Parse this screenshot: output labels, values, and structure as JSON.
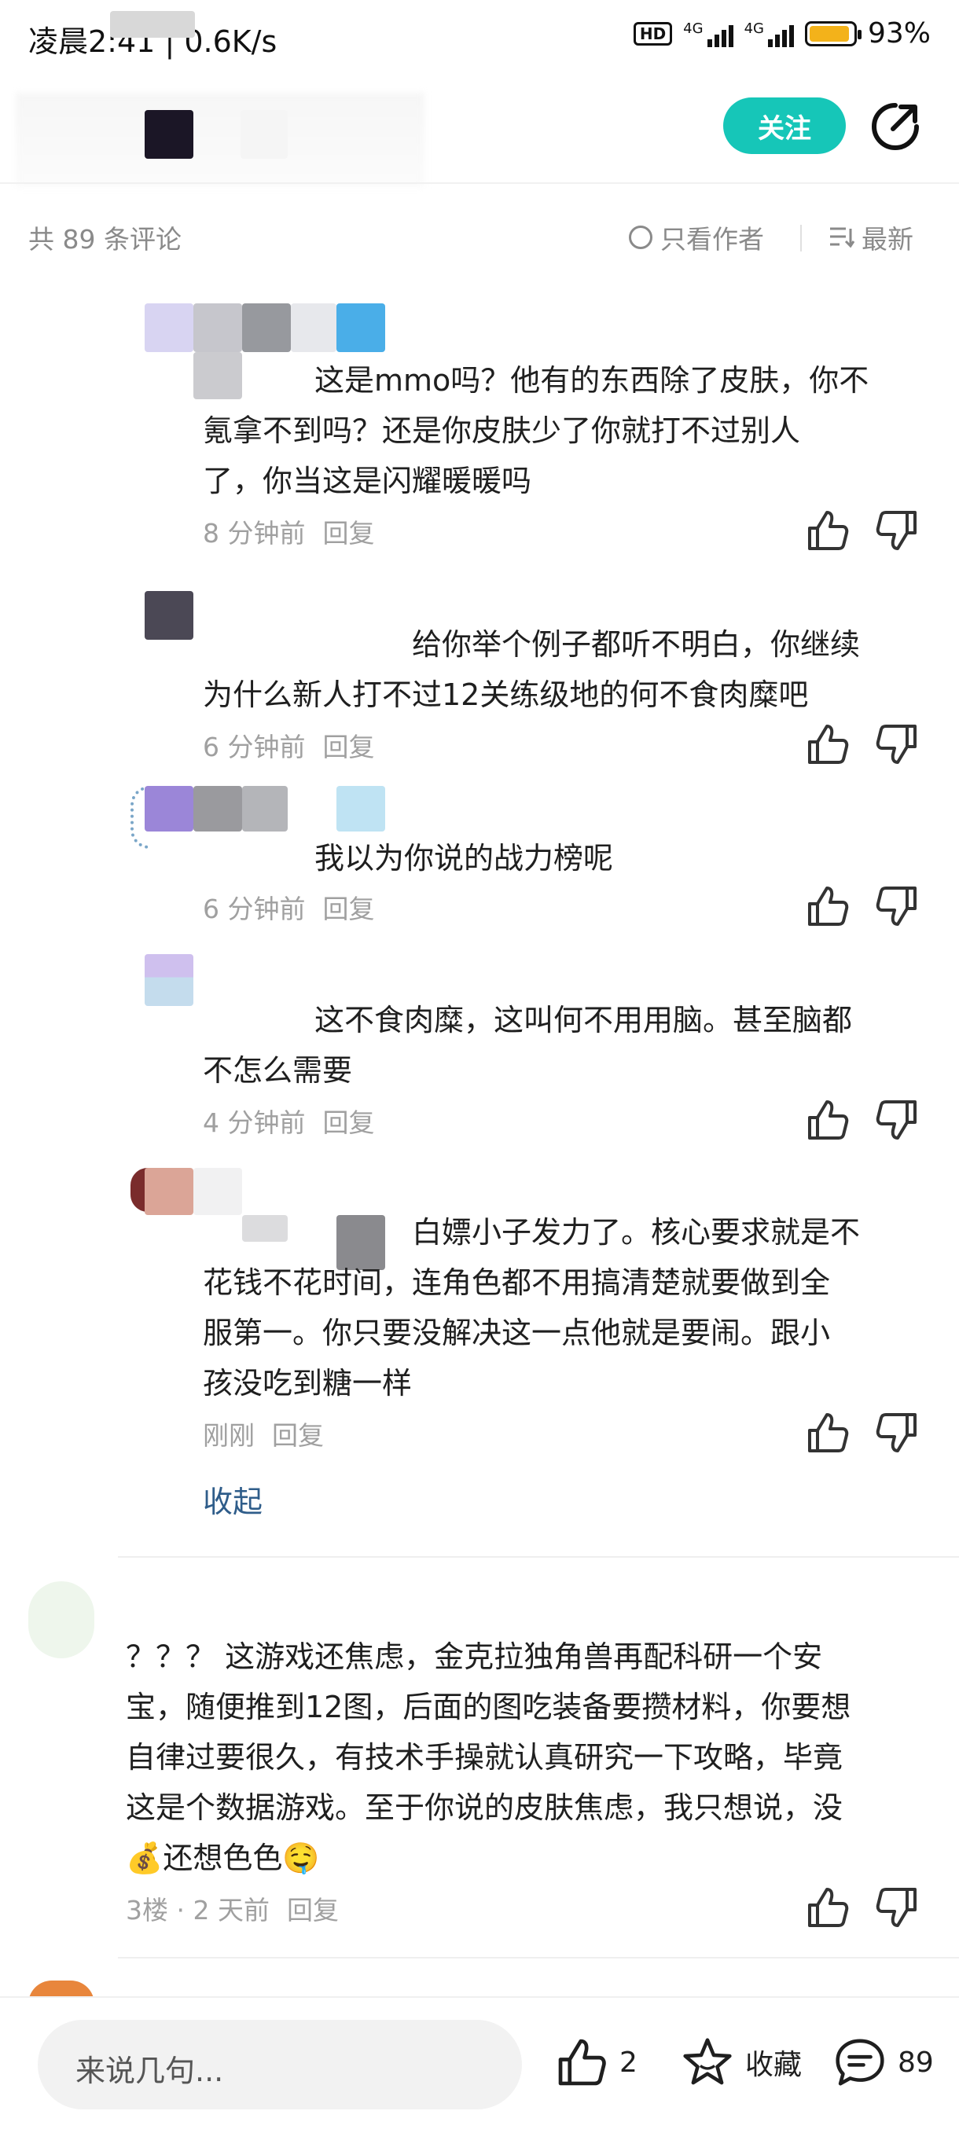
{
  "status_bar": {
    "time": "凌晨2:41",
    "net_speed": "0.6K/s",
    "hd": "HD",
    "sig1_tag": "4G",
    "sig2_tag": "4G",
    "battery_percent": "93%",
    "battery_level": 0.93
  },
  "header": {
    "follow_label": "关注"
  },
  "comments_header": {
    "count_text": "共 89 条评论",
    "author_only_label": "只看作者",
    "sort_label": "最新"
  },
  "replies": [
    {
      "text_line1": "这是mmo吗？他有的东西除了皮肤，你不",
      "text_line2": "氪拿不到吗？还是你皮肤少了你就打不过别人",
      "text_line3": "了，你当这是闪耀暖暖吗",
      "time": "8 分钟前",
      "reply_label": "回复"
    },
    {
      "text_line1": "给你举个例子都听不明白，你继续",
      "text_line2": "为什么新人打不过12关练级地的何不食肉糜吧",
      "time": "6 分钟前",
      "reply_label": "回复"
    },
    {
      "text_line1": "我以为你说的战力榜呢",
      "time": "6 分钟前",
      "reply_label": "回复"
    },
    {
      "text_line1": "这不食肉糜，这叫何不用用脑。甚至脑都",
      "text_line2": "不怎么需要",
      "time": "4 分钟前",
      "reply_label": "回复"
    },
    {
      "text_line1": "白嫖小子发力了。核心要求就是不",
      "text_line2": "花钱不花时间，连角色都不用搞清楚就要做到全",
      "text_line3": "服第一。你只要没解决这一点他就是要闹。跟小",
      "text_line4": "孩没吃到糖一样",
      "time": "刚刚",
      "reply_label": "回复"
    }
  ],
  "collapse_label": "收起",
  "top_comment": {
    "text_line1": "？？？ 这游戏还焦虑，金克拉独角兽再配科研一个安",
    "text_line2": "宝，随便推到12图，后面的图吃装备要攒材料，你要想",
    "text_line3": "自律过要很久，有技术手操就认真研究一下攻略，毕竟",
    "text_line4": "这是个数据游戏。至于你说的皮肤焦虑，我只想说，没",
    "text_line5": "💰还想色色🤤",
    "floor": "3楼",
    "time": "2 天前",
    "reply_label": "回复"
  },
  "bottom_bar": {
    "input_placeholder": "来说几句...",
    "like_count": "2",
    "collect_label": "收藏",
    "comment_count": "89"
  }
}
